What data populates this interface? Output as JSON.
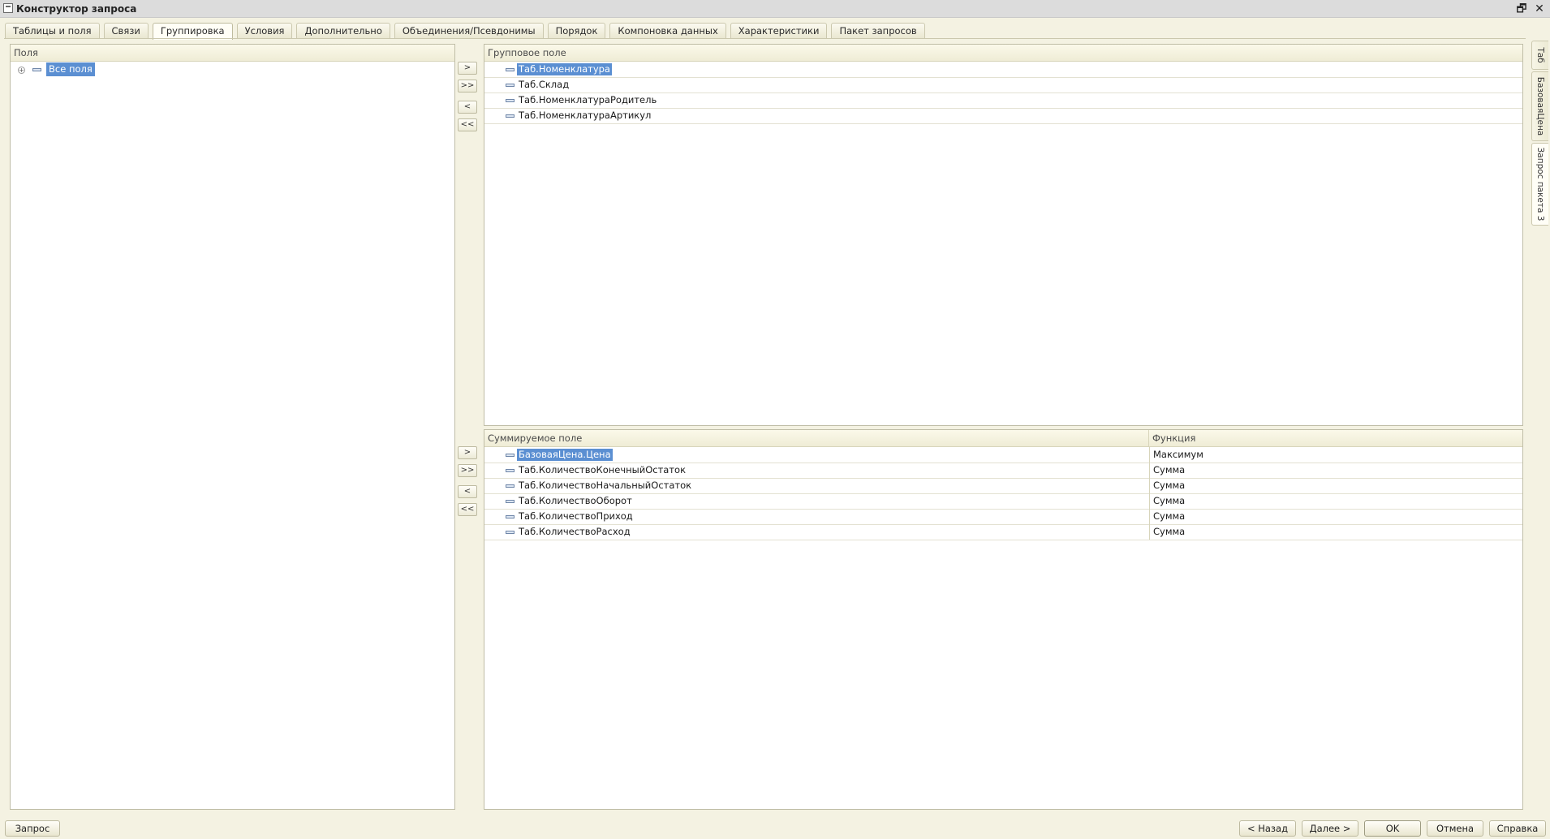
{
  "window": {
    "title": "Конструктор запроса",
    "restore_symbol": "🗗",
    "close_symbol": "✕"
  },
  "tabs": [
    {
      "label": "Таблицы и поля"
    },
    {
      "label": "Связи"
    },
    {
      "label": "Группировка",
      "active": true
    },
    {
      "label": "Условия"
    },
    {
      "label": "Дополнительно"
    },
    {
      "label": "Объединения/Псевдонимы"
    },
    {
      "label": "Порядок"
    },
    {
      "label": "Компоновка данных"
    },
    {
      "label": "Характеристики"
    },
    {
      "label": "Пакет запросов"
    }
  ],
  "fields_panel": {
    "header": "Поля",
    "tree": [
      {
        "label": "Все поля",
        "expander": "+",
        "selected": true
      }
    ]
  },
  "move_buttons": {
    "add": ">",
    "add_all": ">>",
    "remove": "<",
    "remove_all": "<<"
  },
  "group_panel": {
    "header": "Групповое поле",
    "items": [
      {
        "name": "Таб.Номенклатура",
        "selected": true
      },
      {
        "name": "Таб.Склад"
      },
      {
        "name": "Таб.НоменклатураРодитель"
      },
      {
        "name": "Таб.НоменклатураАртикул"
      }
    ]
  },
  "sum_panel": {
    "header_field": "Суммируемое поле",
    "header_function": "Функция",
    "items": [
      {
        "name": "БазоваяЦена.Цена",
        "function": "Максимум",
        "selected": true
      },
      {
        "name": "Таб.КоличествоКонечныйОстаток",
        "function": "Сумма"
      },
      {
        "name": "Таб.КоличествоНачальныйОстаток",
        "function": "Сумма"
      },
      {
        "name": "Таб.КоличествоОборот",
        "function": "Сумма"
      },
      {
        "name": "Таб.КоличествоПриход",
        "function": "Сумма"
      },
      {
        "name": "Таб.КоличествоРасход",
        "function": "Сумма"
      }
    ]
  },
  "side_tabs": [
    {
      "label": "Таб"
    },
    {
      "label": "БазоваяЦена"
    },
    {
      "label": "Запрос пакета 3",
      "active": true
    }
  ],
  "bottom": {
    "query_button": "Запрос",
    "back_button": "< Назад",
    "next_button": "Далее >",
    "ok_button": "OK",
    "cancel_button": "Отмена",
    "help_button": "Справка"
  }
}
